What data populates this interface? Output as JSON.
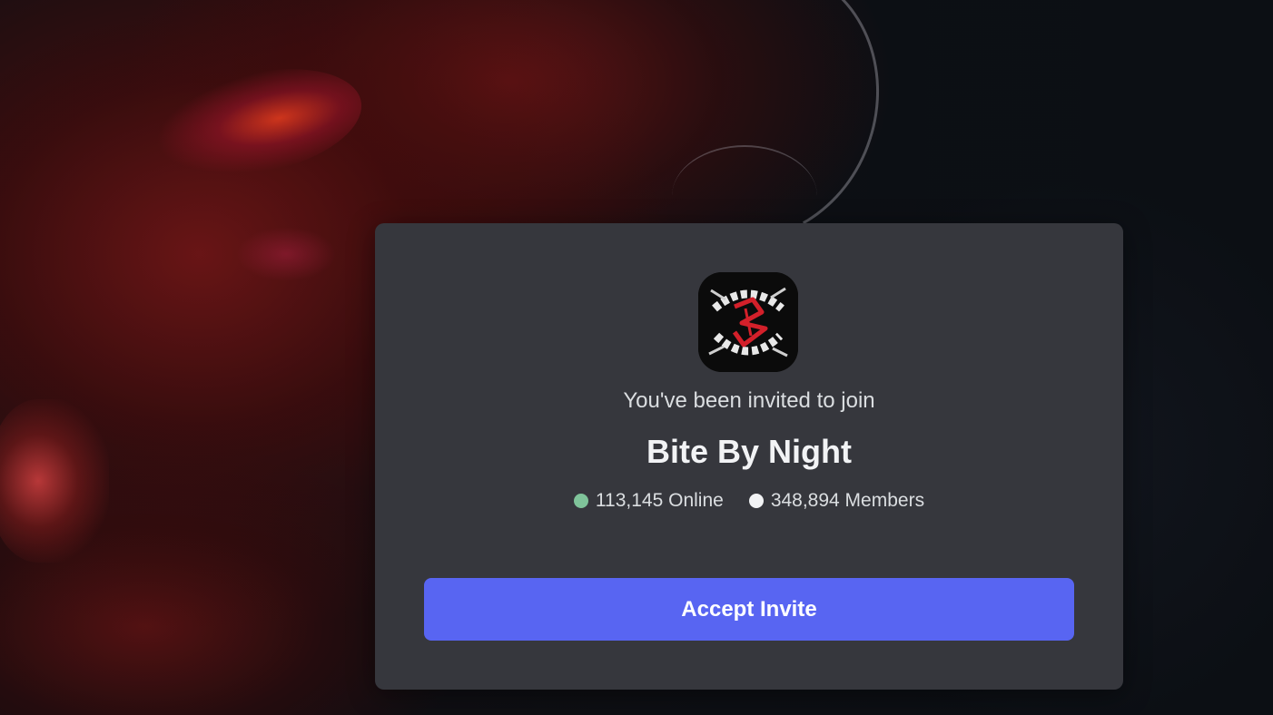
{
  "invite": {
    "subtitle": "You've been invited to join",
    "server_name": "Bite By Night",
    "online_count": "113,145 Online",
    "member_count": "348,894 Members",
    "accept_label": "Accept Invite"
  },
  "icons": {
    "server_icon": "bite-by-night-logo",
    "online_indicator": "green-dot",
    "members_indicator": "white-dot"
  },
  "colors": {
    "card_background": "#36373d",
    "accent": "#5865f2",
    "online": "#7fc39a",
    "members": "#f2f3f5"
  }
}
